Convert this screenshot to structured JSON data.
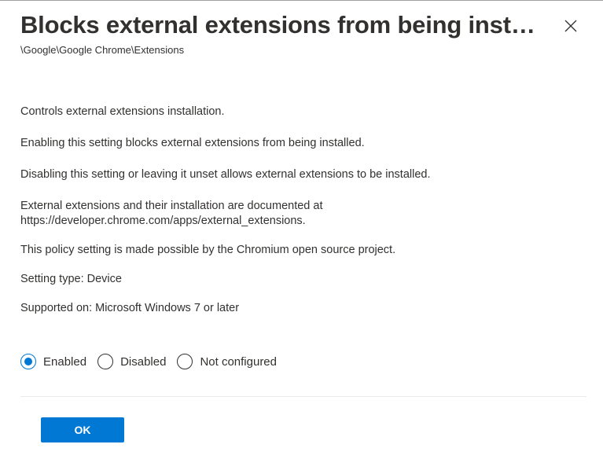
{
  "dialog": {
    "title": "Blocks external extensions from being insta...",
    "path": "\\Google\\Google Chrome\\Extensions",
    "close_icon": "close-icon"
  },
  "description": {
    "p1": "Controls external extensions installation.",
    "p2": "Enabling this setting blocks external extensions from being installed.",
    "p3": "Disabling this setting or leaving it unset allows external extensions to be installed.",
    "p4_line1": "External extensions and their installation are documented at",
    "p4_line2": "https://developer.chrome.com/apps/external_extensions.",
    "p5": "This policy setting is made possible by the Chromium open source project.",
    "setting_type": "Setting type: Device",
    "supported_on": "Supported on: Microsoft Windows 7 or later"
  },
  "options": {
    "selected": "Enabled",
    "items": [
      {
        "label": "Enabled",
        "checked": true
      },
      {
        "label": "Disabled",
        "checked": false
      },
      {
        "label": "Not configured",
        "checked": false
      }
    ]
  },
  "footer": {
    "ok_label": "OK"
  },
  "colors": {
    "accent": "#0078d4",
    "text": "#323130",
    "divider": "#edebe9"
  }
}
